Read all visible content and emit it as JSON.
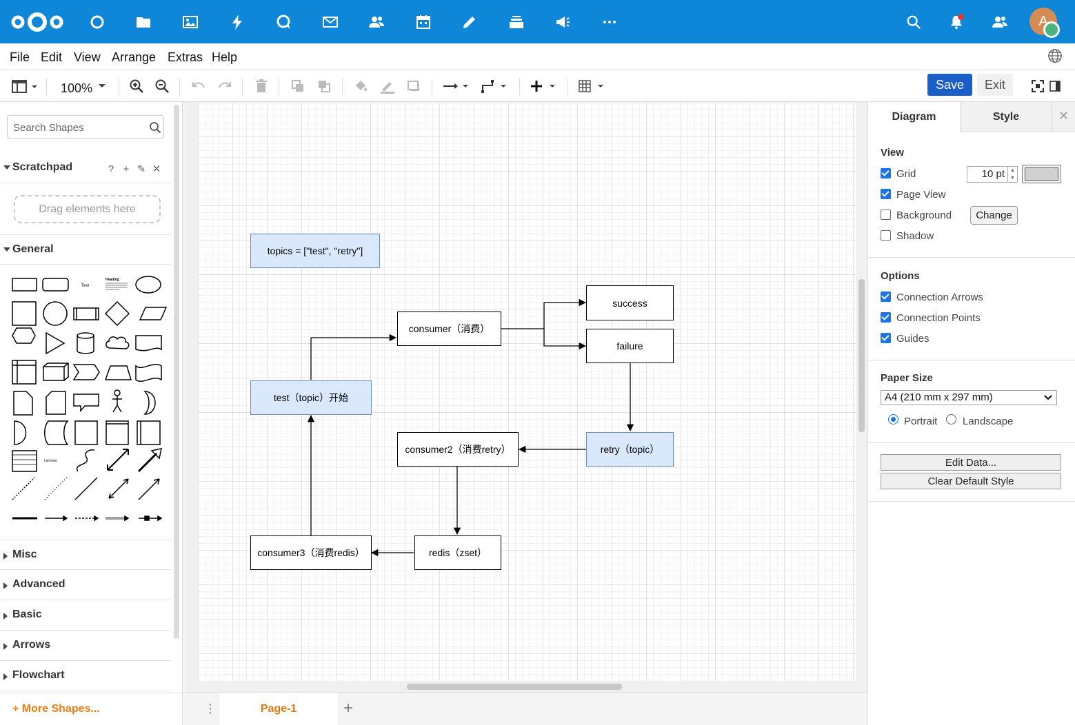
{
  "header": {
    "apps": [
      "dashboard-icon",
      "files-icon",
      "photos-icon",
      "activity-icon",
      "talk-icon",
      "mail-icon",
      "contacts-icon",
      "calendar-icon",
      "notes-icon",
      "deck-icon",
      "announcements-icon",
      "more-apps-icon"
    ],
    "avatar_initial": "A"
  },
  "menubar": {
    "items": [
      "File",
      "Edit",
      "View",
      "Arrange",
      "Extras",
      "Help"
    ]
  },
  "toolbar": {
    "zoom": "100%",
    "save_label": "Save",
    "exit_label": "Exit"
  },
  "sidebar": {
    "search_placeholder": "Search Shapes",
    "scratchpad": {
      "title": "Scratchpad",
      "help": "?",
      "add": "+",
      "edit": "✎",
      "close": "✕",
      "drop_hint": "Drag elements here"
    },
    "sections": [
      "General",
      "Misc",
      "Advanced",
      "Basic",
      "Arrows",
      "Flowchart"
    ],
    "more_shapes": "More Shapes...",
    "palette_text": "Text",
    "palette_heading": "Heading",
    "palette_list_item": "List Item"
  },
  "diagram": {
    "nodes": {
      "topics": "topics = [\"test\", \"retry\"]",
      "consumer": "consumer（消费）",
      "success": "success",
      "failure": "failure",
      "test": "test（topic）开始",
      "retry": "retry（topic）",
      "consumer2": "consumer2（消费retry）",
      "redis": "redis（zset）",
      "consumer3": "consumer3（消费redis）"
    }
  },
  "pages": {
    "menu": "⋮",
    "tabs": [
      "Page-1"
    ],
    "add": "+"
  },
  "format_panel": {
    "tabs": [
      "Diagram",
      "Style"
    ],
    "close": "✕",
    "view": {
      "title": "View",
      "grid": {
        "label": "Grid",
        "checked": true,
        "size": "10 pt"
      },
      "page_view": {
        "label": "Page View",
        "checked": true
      },
      "background": {
        "label": "Background",
        "checked": false,
        "button": "Change"
      },
      "shadow": {
        "label": "Shadow",
        "checked": false
      }
    },
    "options": {
      "title": "Options",
      "connection_arrows": {
        "label": "Connection Arrows",
        "checked": true
      },
      "connection_points": {
        "label": "Connection Points",
        "checked": true
      },
      "guides": {
        "label": "Guides",
        "checked": true
      }
    },
    "paper": {
      "title": "Paper Size",
      "selected": "A4 (210 mm x 297 mm)",
      "portrait": "Portrait",
      "landscape": "Landscape",
      "orientation": "Portrait"
    },
    "buttons": {
      "edit_data": "Edit Data...",
      "clear_style": "Clear Default Style"
    }
  },
  "colors": {
    "header": "#0f87d8",
    "save": "#1a5fc8",
    "accent": "#1a73e8",
    "node_blue_fill": "#dae8fc",
    "node_blue_stroke": "#6c8ebf",
    "more_shapes": "#f07c12"
  }
}
